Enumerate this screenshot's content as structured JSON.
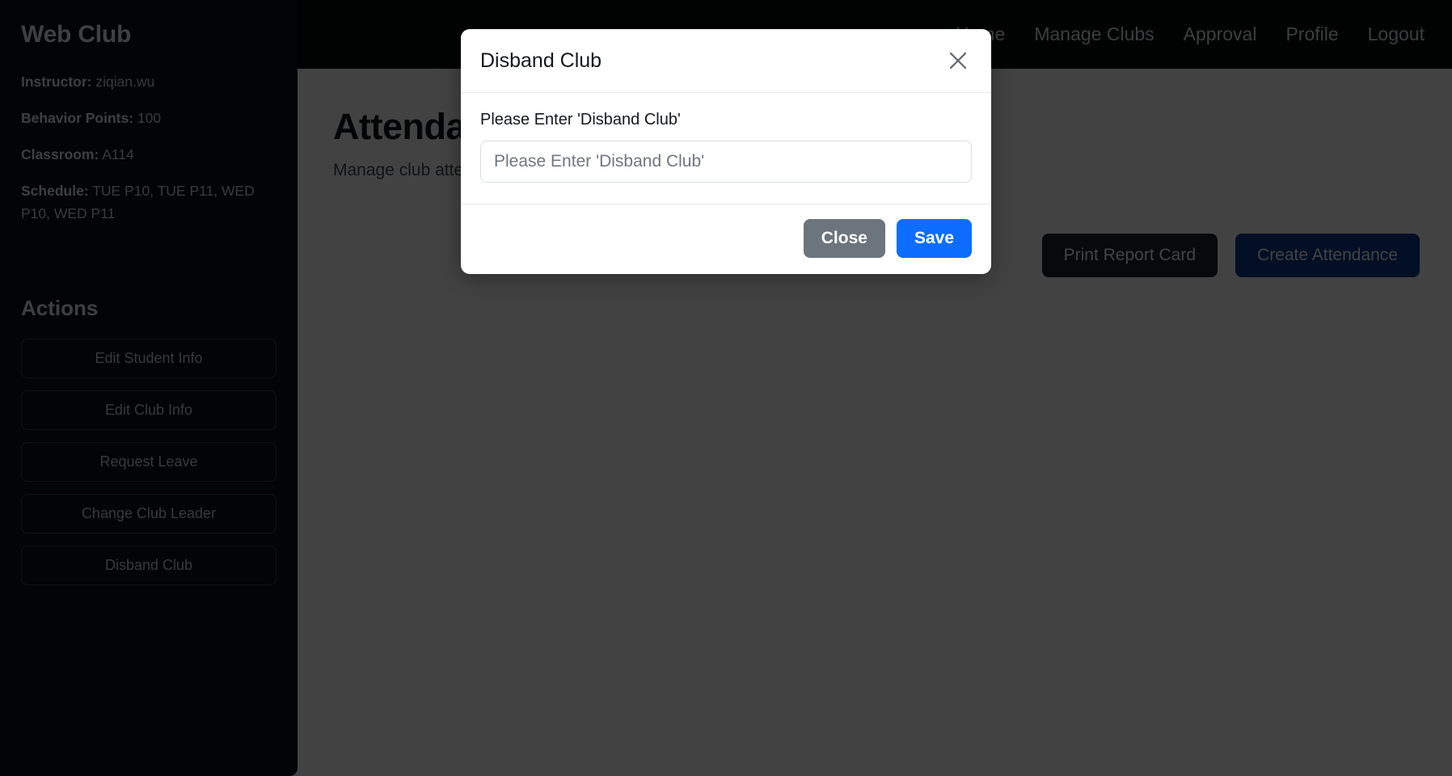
{
  "sidebar": {
    "club_title": "Web Club",
    "meta": [
      {
        "key": "Instructor:",
        "value": "ziqian.wu"
      },
      {
        "key": "Behavior Points:",
        "value": "100"
      },
      {
        "key": "Classroom:",
        "value": "A114"
      },
      {
        "key": "Schedule:",
        "value": "TUE P10, TUE P11, WED P10, WED P11"
      }
    ],
    "actions_heading": "Actions",
    "actions": [
      {
        "label": "Edit Student Info"
      },
      {
        "label": "Edit Club Info"
      },
      {
        "label": "Request Leave"
      },
      {
        "label": "Change Club Leader"
      },
      {
        "label": "Disband Club"
      }
    ]
  },
  "navbar": {
    "links": [
      {
        "label": "Home"
      },
      {
        "label": "Manage Clubs"
      },
      {
        "label": "Approval"
      },
      {
        "label": "Profile"
      },
      {
        "label": "Logout"
      }
    ]
  },
  "content": {
    "title": "Attendance Management",
    "subtitle": "Manage club attendance records.",
    "buttons": [
      {
        "label": "Print Report Card"
      },
      {
        "label": "Create Attendance"
      }
    ]
  },
  "modal": {
    "title": "Disband Club",
    "close_icon": "close-icon",
    "field_label": "Please Enter 'Disband Club'",
    "field_placeholder": "Please Enter 'Disband Club'",
    "field_value": "",
    "close_label": "Close",
    "save_label": "Save"
  },
  "colors": {
    "sidebar_bg": "#0d1117",
    "navbar_bg": "#06080b",
    "backdrop": "rgba(0,0,0,0.74)",
    "primary": "#0d6efd",
    "secondary": "#6c757d",
    "dark_button": "#212529",
    "primary_dark_button": "#0b3d91"
  }
}
